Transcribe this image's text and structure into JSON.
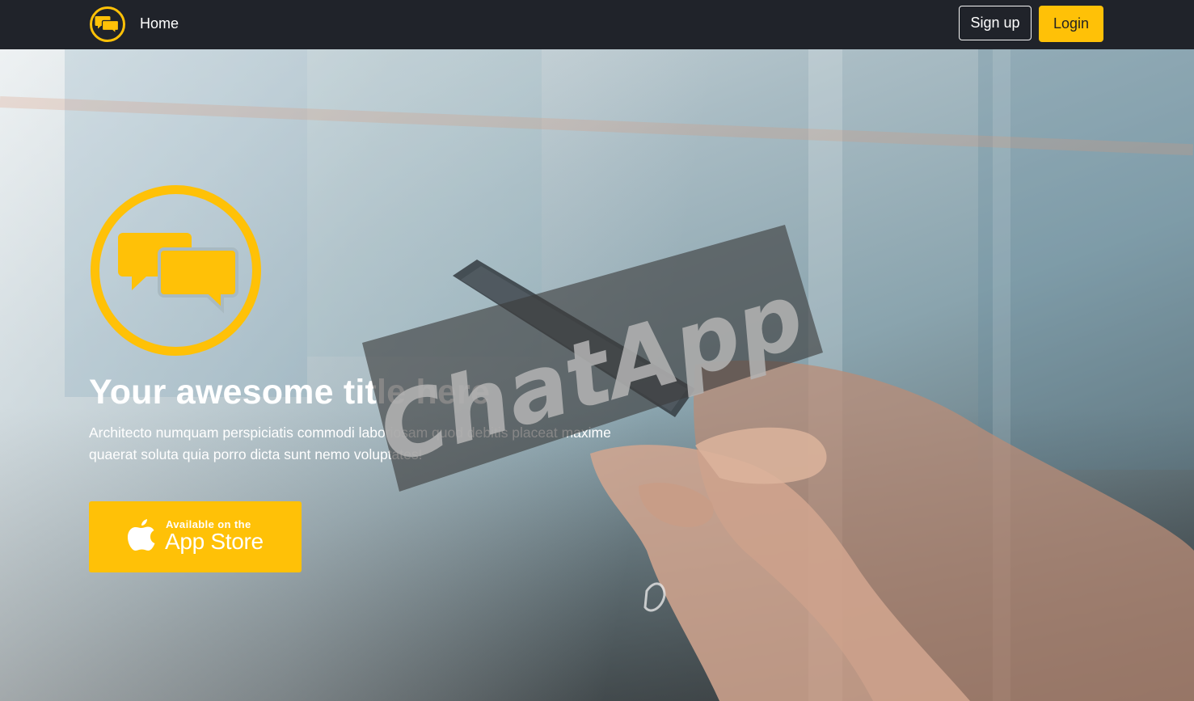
{
  "navbar": {
    "logo_icon": "chat-bubbles-icon",
    "home_label": "Home",
    "signup_label": "Sign up",
    "login_label": "Login"
  },
  "hero": {
    "logo_icon": "chat-bubbles-icon",
    "title": "Your awesome title here",
    "text": "Architecto numquam perspiciatis commodi laboriosam quod debitis placeat maxime quaerat soluta quia porro dicta sunt nemo voluptates!",
    "appstore": {
      "icon": "apple-icon",
      "small_label": "Available on the",
      "big_label": "App Store"
    }
  },
  "watermark": {
    "text": "ChatApp"
  },
  "colors": {
    "accent": "#ffc107",
    "navbar_bg": "#20232a",
    "text_light": "#ffffff"
  }
}
